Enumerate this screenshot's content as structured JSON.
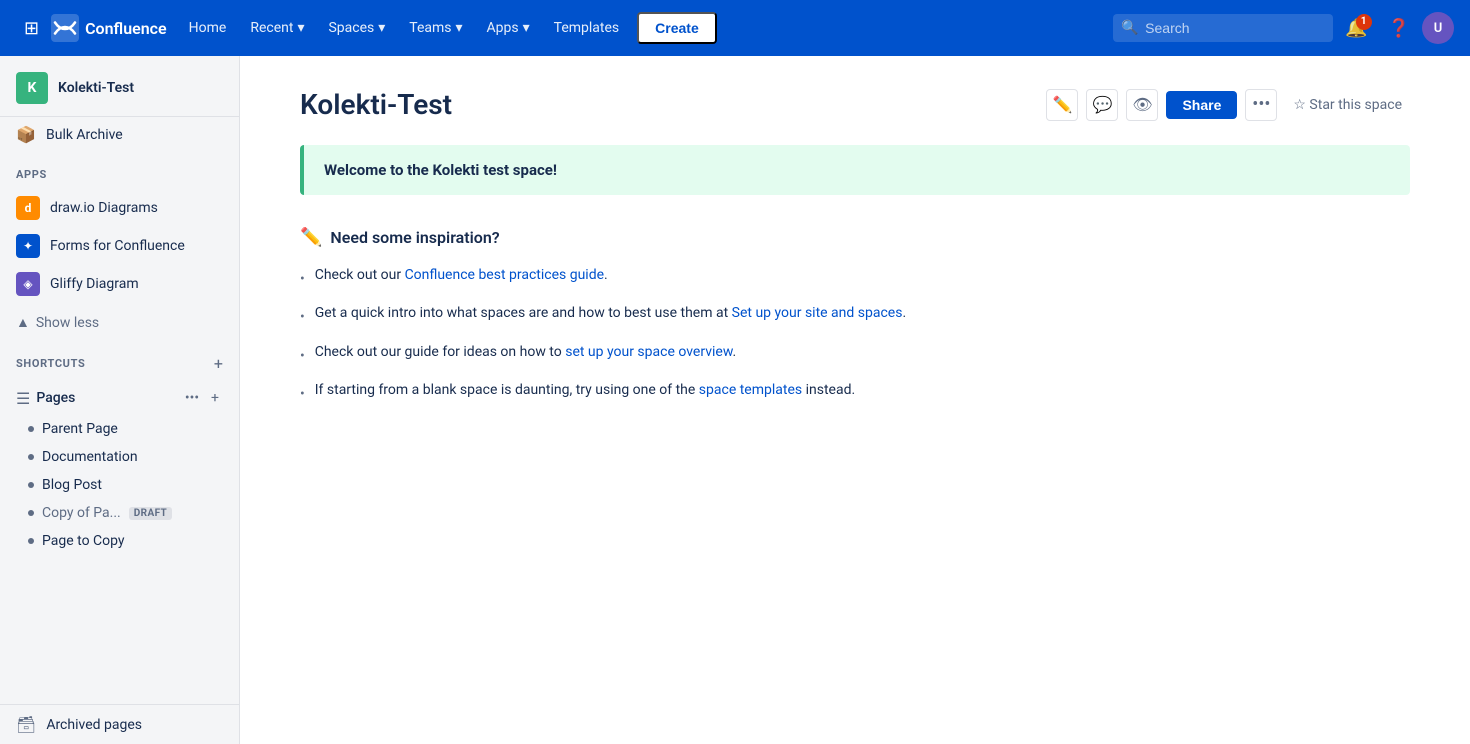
{
  "topnav": {
    "logo_text": "Confluence",
    "items": [
      {
        "label": "Home",
        "has_dropdown": false
      },
      {
        "label": "Recent",
        "has_dropdown": true
      },
      {
        "label": "Spaces",
        "has_dropdown": true
      },
      {
        "label": "Teams",
        "has_dropdown": true
      },
      {
        "label": "Apps",
        "has_dropdown": true
      },
      {
        "label": "Templates",
        "has_dropdown": false
      }
    ],
    "create_label": "Create",
    "search_placeholder": "Search",
    "notification_count": "1"
  },
  "sidebar": {
    "space_name": "Kolekti-Test",
    "space_initial": "K",
    "bulk_archive_label": "Bulk Archive",
    "apps_section_label": "APPS",
    "apps": [
      {
        "name": "draw.io Diagrams",
        "icon_type": "drawio"
      },
      {
        "name": "Forms for Confluence",
        "icon_type": "forms"
      },
      {
        "name": "Gliffy Diagram",
        "icon_type": "gliffy"
      }
    ],
    "show_less_label": "Show less",
    "shortcuts_label": "SHORTCUTS",
    "pages_label": "Pages",
    "page_items": [
      {
        "name": "Parent Page",
        "is_draft": false
      },
      {
        "name": "Documentation",
        "is_draft": false
      },
      {
        "name": "Blog Post",
        "is_draft": false
      },
      {
        "name": "Copy of Pa...",
        "is_draft": true
      },
      {
        "name": "Page to Copy",
        "is_draft": false
      }
    ],
    "archived_pages_label": "Archived pages",
    "draft_badge": "DRAFT"
  },
  "main": {
    "page_title": "Kolekti-Test",
    "star_label": "Star this space",
    "welcome_banner": "Welcome to the Kolekti test space!",
    "inspiration_title": "Need some inspiration?",
    "inspiration_emoji": "✏️",
    "bullets": [
      {
        "text_before": "Check out our ",
        "link_text": "Confluence best practices guide",
        "text_after": "."
      },
      {
        "text_before": "Get a quick intro into what spaces are and how to best use them at ",
        "link_text": "Set up your site and spaces",
        "text_after": "."
      },
      {
        "text_before": "Check out our guide for ideas on how to ",
        "link_text": "set up your space overview",
        "text_after": "."
      },
      {
        "text_before": "If starting from a blank space is daunting, try using one of the ",
        "link_text": "space templates",
        "text_after": " instead."
      }
    ]
  }
}
